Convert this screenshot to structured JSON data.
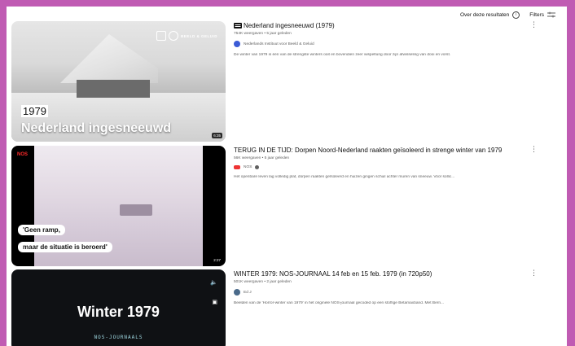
{
  "topbar": {
    "about_label": "Over deze resultaten",
    "filters_label": "Filters"
  },
  "results": [
    {
      "title": "Nederland ingesneeuwd (1979)",
      "stats": "754K weergaven • 5 jaar geleden",
      "channel": "Nederlands Instituut voor Beeld & Geluid",
      "description": "De winter van 1979 is één van de strengste winters ooit en bovendien zeer wispelturig door zijn afwisseling van dooi en vorst.",
      "duration": "6:35",
      "thumb_year": "1979",
      "thumb_title": "Nederland ingesneeuwd",
      "thumb_logo": "BEELD & GELUID"
    },
    {
      "title": "TERUG IN DE TIJD: Dorpen Noord-Nederland raakten geïsoleerd in strenge winter van 1979",
      "stats": "56K weergaven • 5 jaar geleden",
      "channel": "NOS",
      "description": "Het openbare leven lag volledig plat, dorpen raakten geïsoleerd en huizen gingen schuil achter muren van sneeuw. Voor sollic...",
      "duration": "2:27",
      "thumb_logo": "NOS",
      "caption_1": "'Geen ramp,",
      "caption_2": "maar de situatie is beroerd'"
    },
    {
      "title": "WINTER 1979: NOS-JOURNAAL 14 feb en 15 feb. 1979 (in 720p50)",
      "stats": "501K weergaven • 2 jaar geleden",
      "channel": "Ed J",
      "description": "Beelden van de 'Horror-winter van 1979' in het originele NOS-journaal gecoded op een stoffige Betamaxband. Met Bern...",
      "thumb_title": "Winter 1979",
      "thumb_sub": "NOS-JOURNAALS"
    }
  ]
}
